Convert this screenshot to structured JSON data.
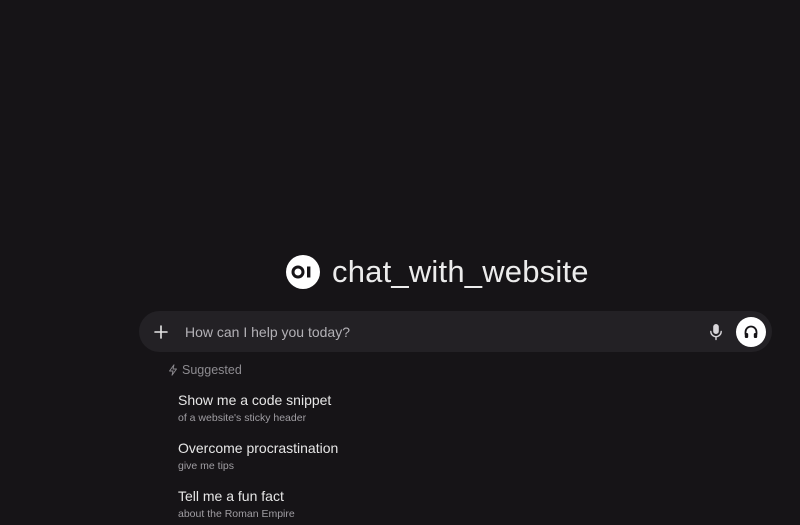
{
  "app": {
    "title": "chat_with_website",
    "logo_text": "OI"
  },
  "chat": {
    "placeholder": "How can I help you today?",
    "value": ""
  },
  "icons": {
    "add": "plus-icon",
    "mic": "microphone-icon",
    "voice": "headphones-icon",
    "suggested": "lightning-icon"
  },
  "colors": {
    "background": "#161417",
    "input_background": "#232125",
    "text": "#e6e6e6",
    "muted": "#8d8b90",
    "voice_button": "#ffffff"
  },
  "suggested": {
    "label": "Suggested",
    "items": [
      {
        "title": "Show me a code snippet",
        "subtitle": "of a website's sticky header"
      },
      {
        "title": "Overcome procrastination",
        "subtitle": "give me tips"
      },
      {
        "title": "Tell me a fun fact",
        "subtitle": "about the Roman Empire"
      }
    ]
  }
}
